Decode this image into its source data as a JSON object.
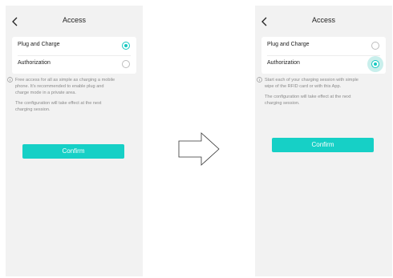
{
  "before": {
    "title": "Access",
    "options": [
      {
        "label": "Plug and Charge",
        "selected": true
      },
      {
        "label": "Authorization",
        "selected": false
      }
    ],
    "info_lines": [
      "Free access for all as simple as charging a mobile",
      "phone. It's recommended to enable plug and",
      "charge mode in a private area."
    ],
    "note_lines": [
      "The configuration will take effect at the next",
      "charging session."
    ],
    "confirm_label": "Confirm"
  },
  "after": {
    "title": "Access",
    "options": [
      {
        "label": "Plug and Charge",
        "selected": false
      },
      {
        "label": "Authorization",
        "selected": true
      }
    ],
    "info_lines": [
      "Start each of your charging session with simple",
      "wipe of the RFID card or with this App."
    ],
    "note_lines": [
      "The configuration will take effect at the next",
      "charging session."
    ],
    "confirm_label": "Confirm"
  },
  "colors": {
    "accent": "#16c8c0",
    "confirm_bg": "#16d0c6",
    "screen_bg": "#f2f2f2",
    "muted_text": "#8a8a8a"
  },
  "icons": {
    "back": "chevron-left-icon",
    "info": "info-circle-icon",
    "transition": "right-arrow-icon"
  }
}
